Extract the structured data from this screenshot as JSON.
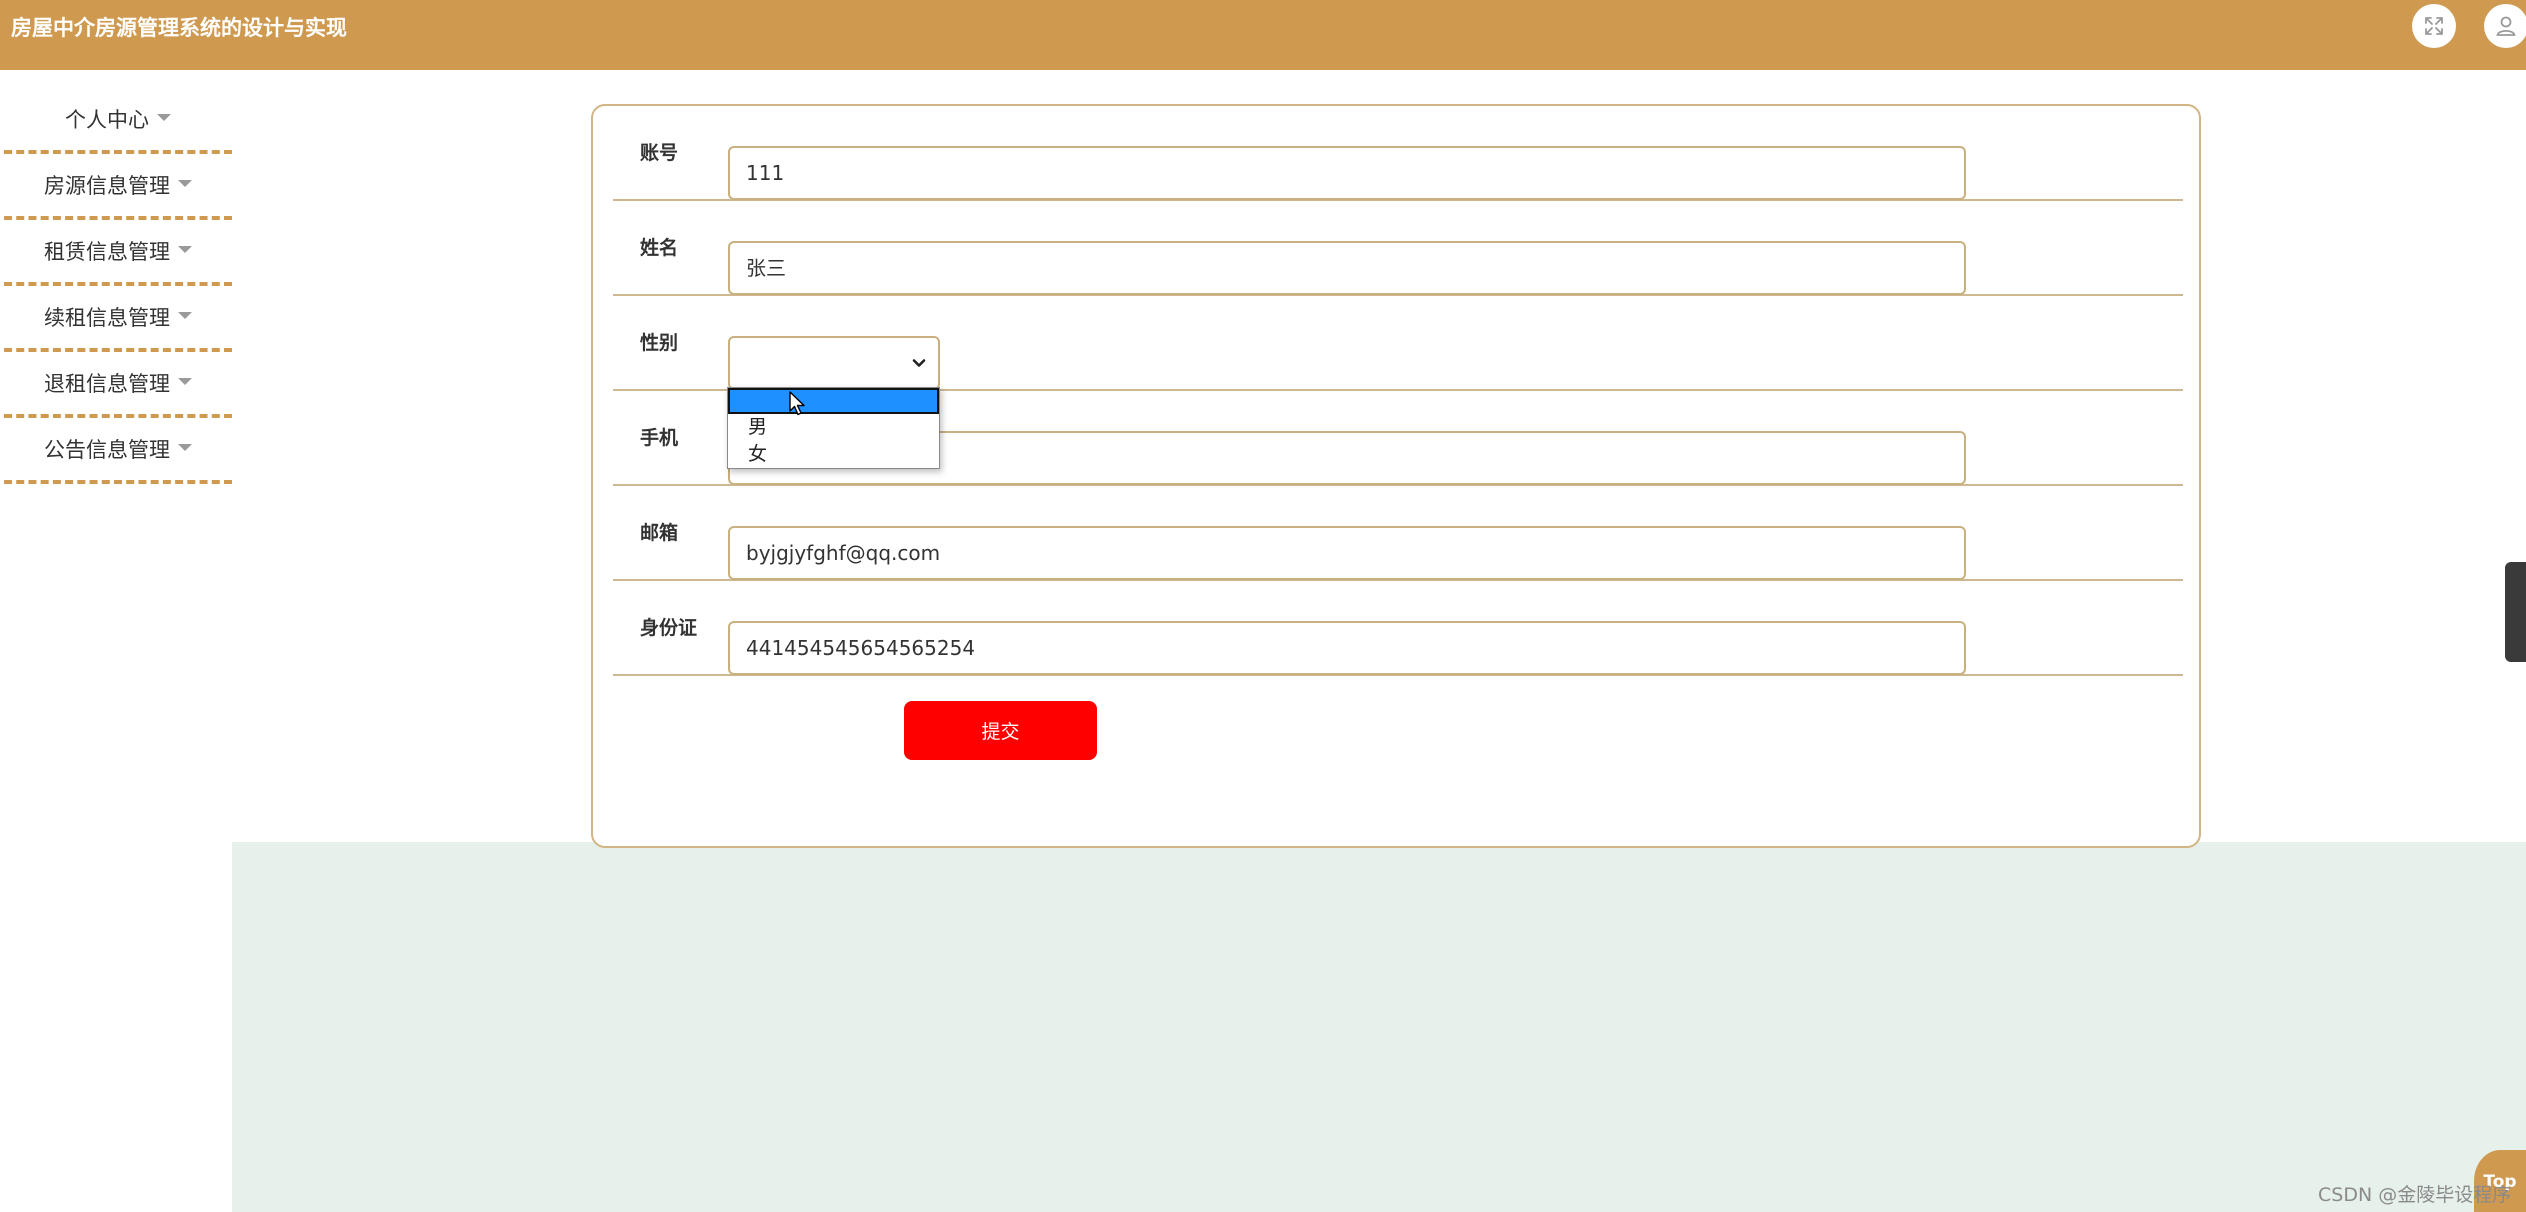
{
  "header": {
    "title": "房屋中介房源管理系统的设计与实现",
    "fullscreen_icon": "expand-arrows-icon",
    "user_icon": "user-icon"
  },
  "sidebar": {
    "items": [
      {
        "label": "个人中心"
      },
      {
        "label": "房源信息管理"
      },
      {
        "label": "租赁信息管理"
      },
      {
        "label": "续租信息管理"
      },
      {
        "label": "退租信息管理"
      },
      {
        "label": "公告信息管理"
      }
    ]
  },
  "form": {
    "account": {
      "label": "账号",
      "value": "111"
    },
    "name": {
      "label": "姓名",
      "value": "张三"
    },
    "gender": {
      "label": "性别",
      "value": "",
      "options": [
        "",
        "男",
        "女"
      ]
    },
    "phone": {
      "label": "手机",
      "value": ""
    },
    "email": {
      "label": "邮箱",
      "value": "byjgjyfghf@qq.com"
    },
    "id_card": {
      "label": "身份证",
      "value": "441454545654565254"
    },
    "submit_label": "提交"
  },
  "top_button": {
    "label": "Top"
  },
  "watermark": "CSDN @金陵毕设程序",
  "colors": {
    "header": "#cf9a50",
    "submit": "#ff0000",
    "card_border": "#d3b585",
    "bottom_bg": "#e7f1ec",
    "dropdown_selected": "#1e90ff"
  }
}
